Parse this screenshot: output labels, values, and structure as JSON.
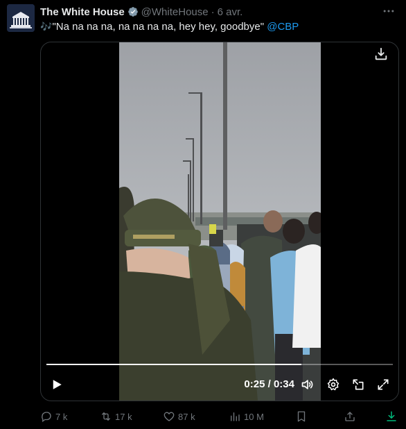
{
  "tweet": {
    "author_name": "The White House",
    "handle": "@WhiteHouse",
    "separator": "·",
    "time": "6 avr.",
    "text_emoji": "🎶",
    "text": "\"Na na na na, na na na na, hey hey, goodbye\"",
    "mention": "@CBP"
  },
  "video": {
    "current_time": "0:25",
    "duration": "0:34",
    "time_separator": " / ",
    "progress_fraction": 0.735
  },
  "actions": {
    "replies": "7 k",
    "reposts": "17 k",
    "likes": "87 k",
    "views": "10 M"
  },
  "colors": {
    "accent": "#1d9bf0",
    "muted": "#71767b",
    "download_green": "#00ba7c"
  },
  "icons": [
    "white-house-logo",
    "verified-badge-icon",
    "more-icon",
    "download-icon",
    "play-icon",
    "volume-icon",
    "settings-icon",
    "pip-icon",
    "fullscreen-icon",
    "reply-icon",
    "repost-icon",
    "like-icon",
    "views-icon",
    "bookmark-icon",
    "share-icon",
    "download-arrow-icon"
  ]
}
